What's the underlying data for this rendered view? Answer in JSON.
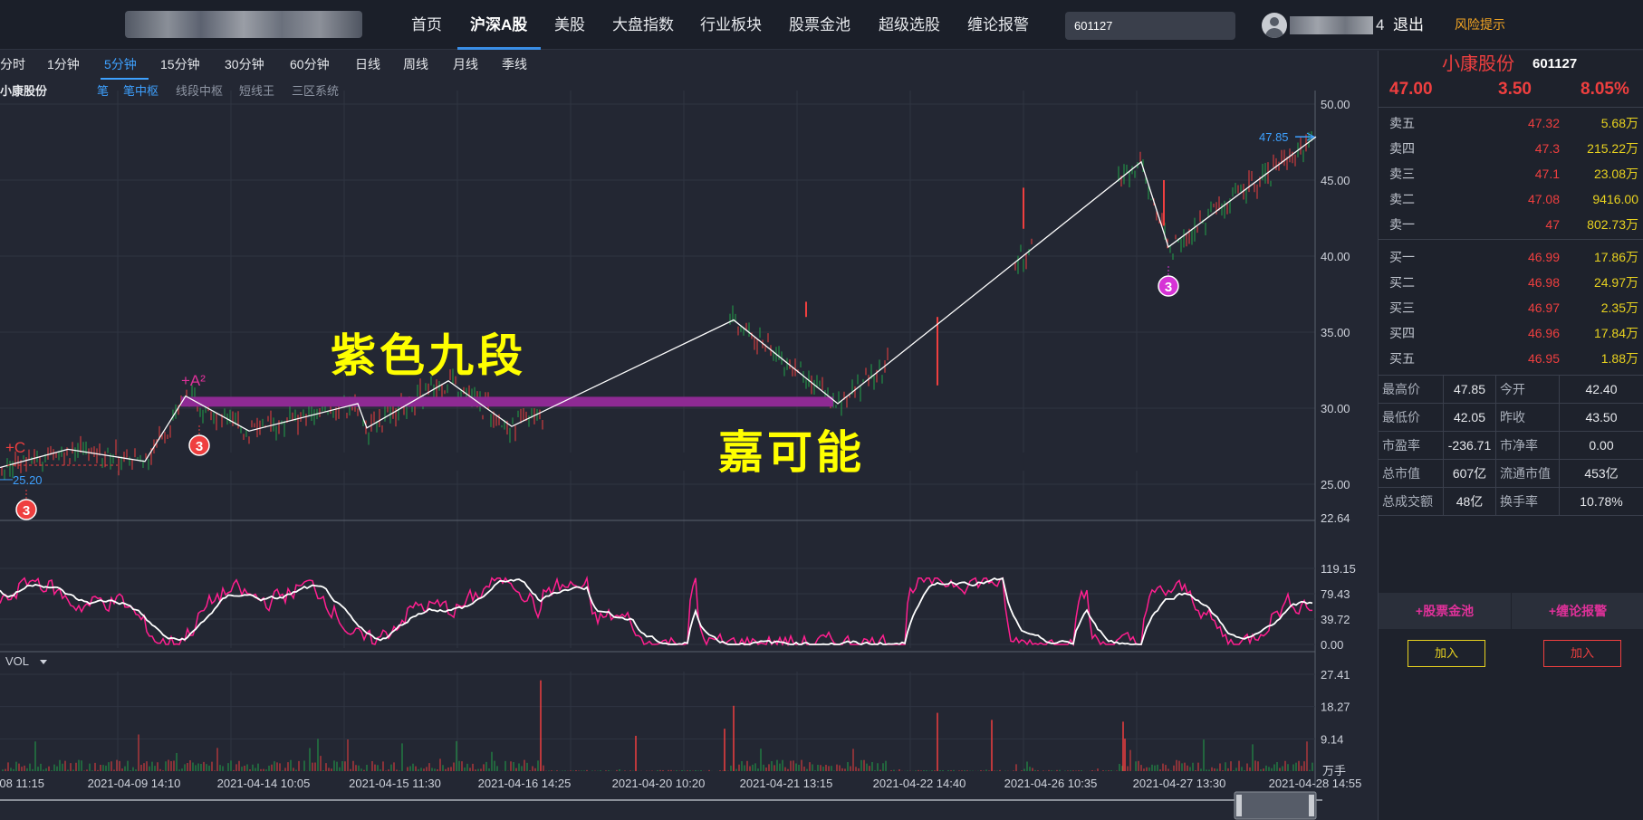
{
  "topbar": {
    "nav": [
      "首页",
      "沪深A股",
      "美股",
      "大盘指数",
      "行业板块",
      "股票金池",
      "超级选股",
      "缠论报警"
    ],
    "active_nav": 1,
    "search_value": "601127",
    "user_suffix": "4",
    "logout": "退出",
    "risk": "风险提示"
  },
  "periods": [
    "分时",
    "1分钟",
    "5分钟",
    "15分钟",
    "30分钟",
    "60分钟",
    "日线",
    "周线",
    "月线",
    "季线"
  ],
  "active_period": 2,
  "stock_mini_name": "小康股份",
  "indicators": [
    "笔",
    "笔中枢",
    "线段中枢",
    "短线王",
    "三区系统"
  ],
  "active_indicators": [
    0,
    1
  ],
  "overlay_text": {
    "top": "紫色九段",
    "bottom": "嘉可能"
  },
  "marks": {
    "plus_c": "+C",
    "plus_a2": "+A²",
    "badge": "3"
  },
  "main_chart": {
    "price_axis": [
      "50.00",
      "45.00",
      "40.00",
      "35.00",
      "30.00",
      "25.00",
      "22.64"
    ],
    "low_label": "25.20",
    "high_label": "47.85"
  },
  "osc_axis": [
    "119.15",
    "79.43",
    "39.72",
    "0.00"
  ],
  "vol": {
    "label": "VOL",
    "axis": [
      "27.41",
      "18.27",
      "9.14"
    ],
    "unit": "万手"
  },
  "x_ticks": [
    "-08 11:15",
    "2021-04-09 14:10",
    "2021-04-14 10:05",
    "2021-04-15 11:30",
    "2021-04-16 14:25",
    "2021-04-20 10:20",
    "2021-04-21 13:15",
    "2021-04-22 14:40",
    "2021-04-26 10:35",
    "2021-04-27 13:30",
    "2021-04-28 14:55"
  ],
  "quote": {
    "name": "小康股份",
    "code": "601127",
    "price": "47.00",
    "change": "3.50",
    "pct": "8.05%"
  },
  "order_book": {
    "asks": [
      {
        "label": "卖五",
        "price": "47.32",
        "vol": "5.68万"
      },
      {
        "label": "卖四",
        "price": "47.3",
        "vol": "215.22万"
      },
      {
        "label": "卖三",
        "price": "47.1",
        "vol": "23.08万"
      },
      {
        "label": "卖二",
        "price": "47.08",
        "vol": "9416.00"
      },
      {
        "label": "卖一",
        "price": "47",
        "vol": "802.73万"
      }
    ],
    "bids": [
      {
        "label": "买一",
        "price": "46.99",
        "vol": "17.86万"
      },
      {
        "label": "买二",
        "price": "46.98",
        "vol": "24.97万"
      },
      {
        "label": "买三",
        "price": "46.97",
        "vol": "2.35万"
      },
      {
        "label": "买四",
        "price": "46.96",
        "vol": "17.84万"
      },
      {
        "label": "买五",
        "price": "46.95",
        "vol": "1.88万"
      }
    ]
  },
  "stats": [
    {
      "l": "最高价",
      "v": "47.85",
      "l2": "今开",
      "v2": "42.40"
    },
    {
      "l": "最低价",
      "v": "42.05",
      "l2": "昨收",
      "v2": "43.50"
    },
    {
      "l": "市盈率",
      "v": "-236.71",
      "l2": "市净率",
      "v2": "0.00"
    },
    {
      "l": "总市值",
      "v": "607亿",
      "l2": "流通市值",
      "v2": "453亿"
    },
    {
      "l": "总成交额",
      "v": "48亿",
      "l2": "换手率",
      "v2": "10.78%"
    }
  ],
  "actions": {
    "pool": "+股票金池",
    "alarm": "+缠论报警",
    "add": "加入",
    "add2": "加入"
  },
  "colors": {
    "up": "#ef3f3f",
    "down": "#22a34a",
    "accent": "#3ea1ff",
    "purple": "#8e2a93",
    "overlay_text": "#ffff00",
    "magenta": "#e0319a",
    "vol_yellow": "#e8d21f",
    "risk": "#f5a623"
  }
}
